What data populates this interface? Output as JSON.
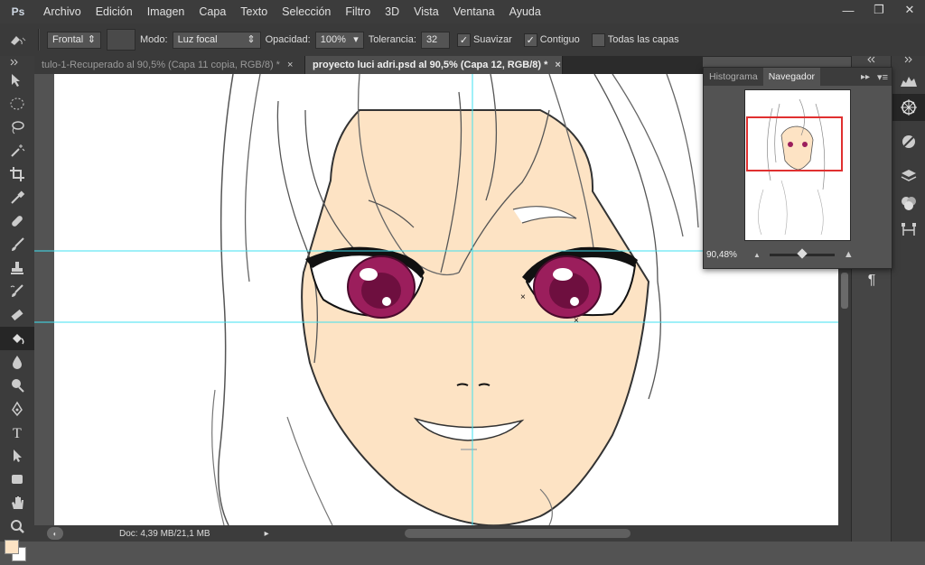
{
  "app": {
    "logo": "Ps"
  },
  "menu": [
    "Archivo",
    "Edición",
    "Imagen",
    "Capa",
    "Texto",
    "Selección",
    "Filtro",
    "3D",
    "Vista",
    "Ventana",
    "Ayuda"
  ],
  "window_controls": {
    "minimize": "—",
    "restore": "❐",
    "close": "✕"
  },
  "options": {
    "brush_preset": "Frontal",
    "mode_label": "Modo:",
    "mode_value": "Luz focal",
    "opacity_label": "Opacidad:",
    "opacity_value": "100%",
    "tolerance_label": "Tolerancia:",
    "tolerance_value": "32",
    "smooth_label": "Suavizar",
    "smooth_checked": true,
    "contiguous_label": "Contiguo",
    "contiguous_checked": true,
    "all_layers_label": "Todas las capas",
    "all_layers_checked": false
  },
  "tabs": [
    {
      "label": "tulo-1-Recuperado al 90,5% (Capa 11 copia, RGB/8) *",
      "active": false
    },
    {
      "label": "proyecto luci adri.psd al 90,5% (Capa 12, RGB/8) *",
      "active": true
    }
  ],
  "tab_close": "×",
  "navigator": {
    "tabs": [
      "Histograma",
      "Navegador"
    ],
    "active_tab": "Navegador",
    "zoom": "90,48%",
    "view_box_color": "#e03030"
  },
  "status": {
    "doc": "Doc: 4,39 MB/21,1 MB"
  },
  "colors": {
    "skin": "#fde3c4",
    "iris": "#9b1e5c",
    "guide": "#3fe0f0",
    "ui_dark": "#3c3c3c"
  }
}
